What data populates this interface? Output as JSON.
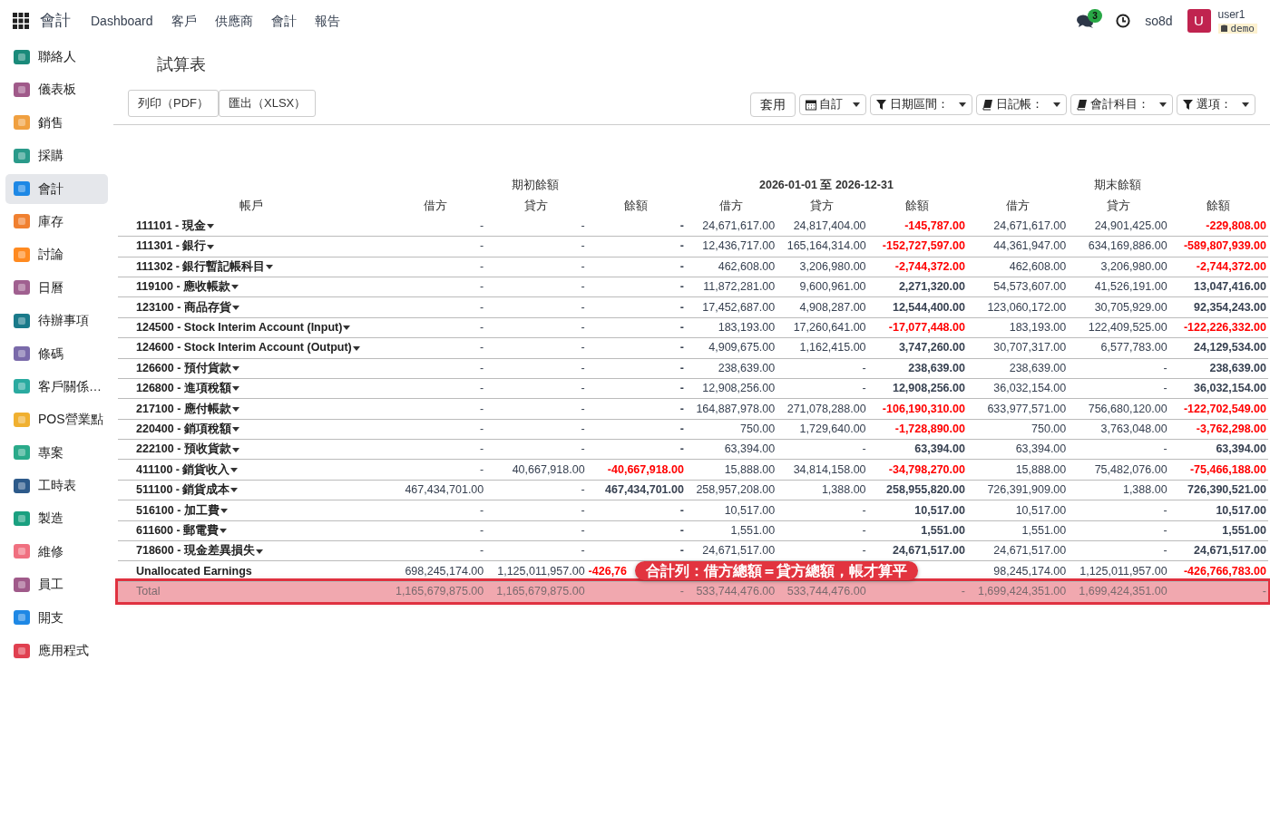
{
  "navbar": {
    "app": "會計",
    "menu": [
      "Dashboard",
      "客戶",
      "供應商",
      "會計",
      "報告"
    ],
    "message_count": "3",
    "company": "so8d",
    "avatar": "U",
    "user": "user1",
    "database": "demo"
  },
  "sidebar": {
    "items": [
      {
        "label": "聯絡人",
        "selected": false
      },
      {
        "label": "儀表板",
        "selected": false
      },
      {
        "label": "銷售",
        "selected": false
      },
      {
        "label": "採購",
        "selected": false
      },
      {
        "label": "會計",
        "selected": true
      },
      {
        "label": "庫存",
        "selected": false
      },
      {
        "label": "討論",
        "selected": false
      },
      {
        "label": "日曆",
        "selected": false
      },
      {
        "label": "待辦事項",
        "selected": false
      },
      {
        "label": "條碼",
        "selected": false
      },
      {
        "label": "客戶關係…",
        "selected": false
      },
      {
        "label": "POS營業點",
        "selected": false
      },
      {
        "label": "專案",
        "selected": false
      },
      {
        "label": "工時表",
        "selected": false
      },
      {
        "label": "製造",
        "selected": false
      },
      {
        "label": "維修",
        "selected": false
      },
      {
        "label": "員工",
        "selected": false
      },
      {
        "label": "開支",
        "selected": false
      },
      {
        "label": "應用程式",
        "selected": false
      }
    ]
  },
  "page": {
    "title": "試算表",
    "actions": [
      "列印（PDF）",
      "匯出（XLSX）"
    ],
    "apply": "套用",
    "filters": [
      {
        "kind": "calendar",
        "label": "自訂"
      },
      {
        "kind": "filter",
        "label": "日期區間："
      },
      {
        "kind": "book",
        "label": "日記帳："
      },
      {
        "kind": "book",
        "label": "會計科目："
      },
      {
        "kind": "filter",
        "label": "選項："
      }
    ]
  },
  "table": {
    "account_header": "帳戶",
    "groups": [
      {
        "title": "期初餘額",
        "columns": [
          "借方",
          "貸方",
          "餘額"
        ]
      },
      {
        "title": "2026-01-01 至 2026-12-31",
        "columns": [
          "借方",
          "貸方",
          "餘額"
        ]
      },
      {
        "title": "期末餘額",
        "columns": [
          "借方",
          "貸方",
          "餘額"
        ]
      }
    ],
    "rows": [
      {
        "kind": "account",
        "account": "111101 - 現金",
        "values": [
          "-",
          "-",
          "-",
          "24,671,617.00",
          "24,817,404.00",
          {
            "text": "-145,787.00",
            "negative": true
          },
          "24,671,617.00",
          "24,901,425.00",
          {
            "text": "-229,808.00",
            "negative": true
          }
        ]
      },
      {
        "kind": "account",
        "account": "111301 - 銀行",
        "values": [
          "-",
          "-",
          "-",
          "12,436,717.00",
          "165,164,314.00",
          {
            "text": "-152,727,597.00",
            "negative": true
          },
          "44,361,947.00",
          "634,169,886.00",
          {
            "text": "-589,807,939.00",
            "negative": true
          }
        ]
      },
      {
        "kind": "account",
        "account": "111302 - 銀行暫記帳科目",
        "values": [
          "-",
          "-",
          "-",
          "462,608.00",
          "3,206,980.00",
          {
            "text": "-2,744,372.00",
            "negative": true
          },
          "462,608.00",
          "3,206,980.00",
          {
            "text": "-2,744,372.00",
            "negative": true
          }
        ]
      },
      {
        "kind": "account",
        "account": "119100 - 應收帳款",
        "values": [
          "-",
          "-",
          "-",
          "11,872,281.00",
          "9,600,961.00",
          {
            "text": "2,271,320.00",
            "negative": false
          },
          "54,573,607.00",
          "41,526,191.00",
          {
            "text": "13,047,416.00",
            "negative": false
          }
        ]
      },
      {
        "kind": "account",
        "account": "123100 - 商品存貨",
        "values": [
          "-",
          "-",
          "-",
          "17,452,687.00",
          "4,908,287.00",
          {
            "text": "12,544,400.00",
            "negative": false
          },
          "123,060,172.00",
          "30,705,929.00",
          {
            "text": "92,354,243.00",
            "negative": false
          }
        ]
      },
      {
        "kind": "account",
        "account": "124500 - Stock Interim Account (Input)",
        "values": [
          "-",
          "-",
          "-",
          "183,193.00",
          "17,260,641.00",
          {
            "text": "-17,077,448.00",
            "negative": true
          },
          "183,193.00",
          "122,409,525.00",
          {
            "text": "-122,226,332.00",
            "negative": true
          }
        ]
      },
      {
        "kind": "account",
        "account": "124600 - Stock Interim Account (Output)",
        "values": [
          "-",
          "-",
          "-",
          "4,909,675.00",
          "1,162,415.00",
          {
            "text": "3,747,260.00",
            "negative": false
          },
          "30,707,317.00",
          "6,577,783.00",
          {
            "text": "24,129,534.00",
            "negative": false
          }
        ]
      },
      {
        "kind": "account",
        "account": "126600 - 預付貨款",
        "values": [
          "-",
          "-",
          "-",
          "238,639.00",
          "-",
          {
            "text": "238,639.00",
            "negative": false
          },
          "238,639.00",
          "-",
          {
            "text": "238,639.00",
            "negative": false
          }
        ]
      },
      {
        "kind": "account",
        "account": "126800 - 進項稅額",
        "values": [
          "-",
          "-",
          "-",
          "12,908,256.00",
          "-",
          {
            "text": "12,908,256.00",
            "negative": false
          },
          "36,032,154.00",
          "-",
          {
            "text": "36,032,154.00",
            "negative": false
          }
        ]
      },
      {
        "kind": "account",
        "account": "217100 - 應付帳款",
        "values": [
          "-",
          "-",
          "-",
          "164,887,978.00",
          "271,078,288.00",
          {
            "text": "-106,190,310.00",
            "negative": true
          },
          "633,977,571.00",
          "756,680,120.00",
          {
            "text": "-122,702,549.00",
            "negative": true
          }
        ]
      },
      {
        "kind": "account",
        "account": "220400 - 銷項稅額",
        "values": [
          "-",
          "-",
          "-",
          "750.00",
          "1,729,640.00",
          {
            "text": "-1,728,890.00",
            "negative": true
          },
          "750.00",
          "3,763,048.00",
          {
            "text": "-3,762,298.00",
            "negative": true
          }
        ]
      },
      {
        "kind": "account",
        "account": "222100 - 預收貨款",
        "values": [
          "-",
          "-",
          "-",
          "63,394.00",
          "-",
          {
            "text": "63,394.00",
            "negative": false
          },
          "63,394.00",
          "-",
          {
            "text": "63,394.00",
            "negative": false
          }
        ]
      },
      {
        "kind": "account",
        "account": "411100 - 銷貨收入",
        "values": [
          "-",
          "40,667,918.00",
          {
            "text": "-40,667,918.00",
            "negative": true
          },
          "15,888.00",
          "34,814,158.00",
          {
            "text": "-34,798,270.00",
            "negative": true
          },
          "15,888.00",
          "75,482,076.00",
          {
            "text": "-75,466,188.00",
            "negative": true
          }
        ]
      },
      {
        "kind": "account",
        "account": "511100 - 銷貨成本",
        "values": [
          "467,434,701.00",
          "-",
          {
            "text": "467,434,701.00",
            "negative": false
          },
          "258,957,208.00",
          "1,388.00",
          {
            "text": "258,955,820.00",
            "negative": false
          },
          "726,391,909.00",
          "1,388.00",
          {
            "text": "726,390,521.00",
            "negative": false
          }
        ]
      },
      {
        "kind": "account",
        "account": "516100 - 加工費",
        "values": [
          "-",
          "-",
          "-",
          "10,517.00",
          "-",
          {
            "text": "10,517.00",
            "negative": false
          },
          "10,517.00",
          "-",
          {
            "text": "10,517.00",
            "negative": false
          }
        ]
      },
      {
        "kind": "account",
        "account": "611600 - 郵電費",
        "values": [
          "-",
          "-",
          "-",
          "1,551.00",
          "-",
          {
            "text": "1,551.00",
            "negative": false
          },
          "1,551.00",
          "-",
          {
            "text": "1,551.00",
            "negative": false
          }
        ]
      },
      {
        "kind": "account",
        "account": "718600 - 現金差異損失",
        "values": [
          "-",
          "-",
          "-",
          "24,671,517.00",
          "-",
          {
            "text": "24,671,517.00",
            "negative": false
          },
          "24,671,517.00",
          "-",
          {
            "text": "24,671,517.00",
            "negative": false
          }
        ]
      },
      {
        "kind": "earnings",
        "account": "Unallocated Earnings",
        "left_values": [
          "698,245,174.00",
          "1,125,011,957.00",
          {
            "text": "-426,76",
            "negative": true
          }
        ],
        "right_values": [
          "98,245,174.00",
          "1,125,011,957.00",
          {
            "text": "-426,766,783.00",
            "negative": true
          }
        ]
      },
      {
        "kind": "total",
        "account": "Total",
        "values": [
          "1,165,679,875.00",
          "1,165,679,875.00",
          "-",
          "533,744,476.00",
          "533,744,476.00",
          "-",
          "1,699,424,351.00",
          "1,699,424,351.00",
          "-"
        ],
        "highlighted": true
      }
    ]
  },
  "annotation": "合計列：借方總額＝貸方總額，帳才算平"
}
